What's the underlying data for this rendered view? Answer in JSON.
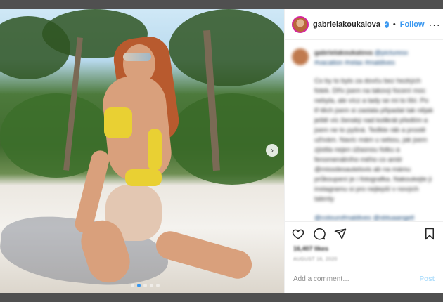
{
  "post": {
    "username": "gabrielakoukalova",
    "separator": "•",
    "follow_label": "Follow",
    "more_label": "···",
    "verified_symbol": "✓"
  },
  "caption": {
    "username": "gabrielakoukalova",
    "tags_line": "@picturesx #vacation #relax #maldives",
    "body": "Co by to bylo za dovču bez hezkých fotek. Dřív jsem na takový focení moc nebyla, ale vícz a tady se mi to líbí. Po tř-těch jsem si zaslala připadat tak nějak ještě víc ženský nad kolikrát předtím a jsem ne to pyšná. Teďkle ráb a prostě užívám. Navíc mám u sebou, jak jsem zjistila nejen úžasnou fotku a fenomenálního mého co amiir @missdesautelsvis ab na mámu průkoupení je i fotografka. Nakoukejte ji instagramu si pro nejlepší v nových talenty",
    "mentions": "@colourofmaldives @sbtuaangell"
  },
  "stats": {
    "likes": "16,407 likes",
    "date": "AUGUST 16, 2020"
  },
  "comment": {
    "placeholder": "Add a comment…",
    "post_label": "Post"
  },
  "carousel": {
    "next_symbol": "›",
    "slides": 5,
    "active_index": 1
  },
  "colors": {
    "accent": "#3897f0",
    "text": "#262626",
    "muted": "#8e8e8e",
    "backdrop": "#505050"
  },
  "icons": [
    "heart-icon",
    "comment-icon",
    "share-icon",
    "bookmark-icon",
    "chevron-right-icon",
    "verified-icon"
  ]
}
